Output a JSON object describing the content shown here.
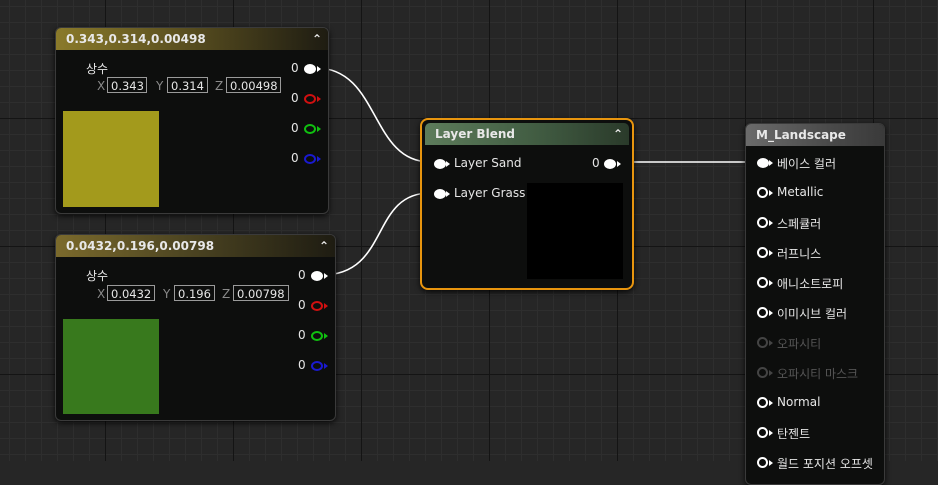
{
  "colors": {
    "const1_header": "#8a7a2a",
    "const2_header": "#7b6a2c",
    "layer_blend_header": "#4a6a4a",
    "material_header": "#5a5a5a",
    "selection_outline": "#e8950e",
    "swatch1": "#a39a1c",
    "swatch2": "#38791d",
    "pin_red": "#d01010",
    "pin_green": "#10c010",
    "pin_blue": "#1a1ad0"
  },
  "constant1": {
    "title": "0.343,0.314,0.00498",
    "type_label": "상수",
    "x_label": "X",
    "x_value": "0.343",
    "y_label": "Y",
    "y_value": "0.314",
    "z_label": "Z",
    "z_value": "0.00498",
    "out_rgb": "0",
    "out_r": "0",
    "out_g": "0",
    "out_b": "0",
    "collapse_glyph": "⌃"
  },
  "constant2": {
    "title": "0.0432,0.196,0.00798",
    "type_label": "상수",
    "x_label": "X",
    "x_value": "0.0432",
    "y_label": "Y",
    "y_value": "0.196",
    "z_label": "Z",
    "z_value": "0.00798",
    "out_rgb": "0",
    "out_r": "0",
    "out_g": "0",
    "out_b": "0",
    "collapse_glyph": "⌃"
  },
  "layer_blend": {
    "title": "Layer Blend",
    "input1": "Layer Sand",
    "input2": "Layer Grass",
    "output": "0",
    "collapse_glyph": "⌃"
  },
  "material": {
    "title": "M_Landscape",
    "inputs": [
      {
        "label": "베이스 컬러",
        "enabled": true
      },
      {
        "label": "Metallic",
        "enabled": true
      },
      {
        "label": "스페큘러",
        "enabled": true
      },
      {
        "label": "러프니스",
        "enabled": true
      },
      {
        "label": "애니소트로피",
        "enabled": true
      },
      {
        "label": "이미시브 컬러",
        "enabled": true
      },
      {
        "label": "오파시티",
        "enabled": false
      },
      {
        "label": "오파시티 마스크",
        "enabled": false
      },
      {
        "label": "Normal",
        "enabled": true
      },
      {
        "label": "탄젠트",
        "enabled": true
      },
      {
        "label": "월드 포지션 오프셋",
        "enabled": true
      }
    ]
  }
}
